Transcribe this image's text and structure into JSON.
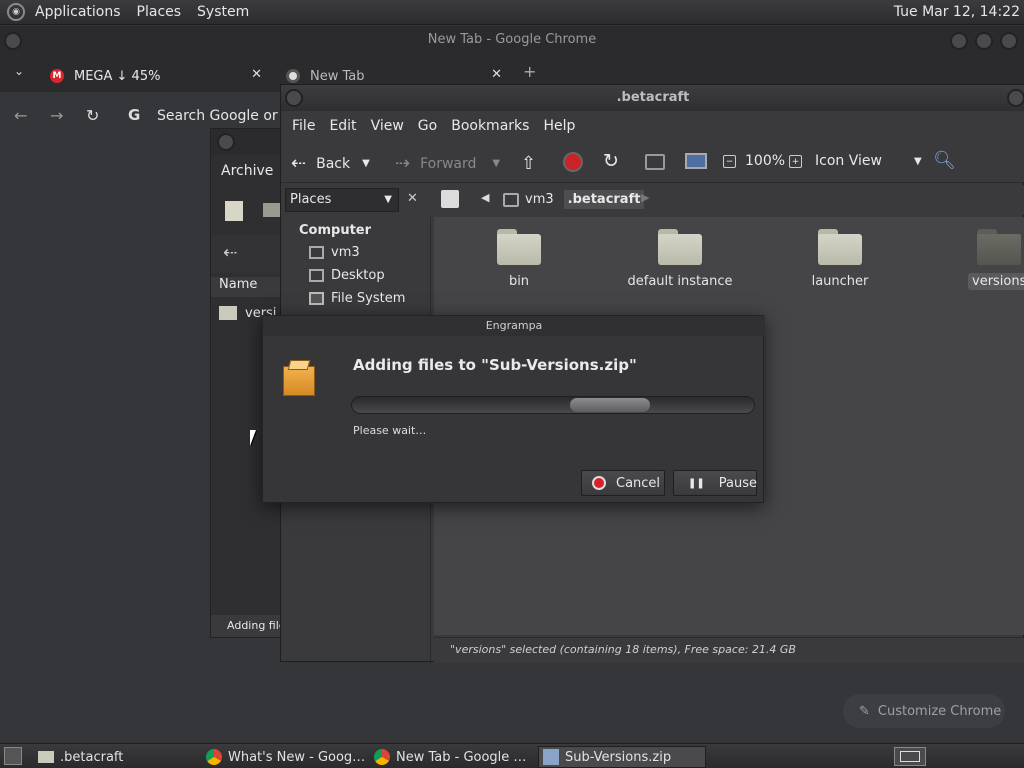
{
  "top_panel": {
    "menus": [
      "Applications",
      "Places",
      "System"
    ],
    "clock": "Tue Mar 12, 14:22"
  },
  "chrome": {
    "title": "New Tab - Google Chrome",
    "tabs": [
      {
        "label": "MEGA ↓ 45%",
        "favicon": "mega-icon",
        "close": "✕"
      },
      {
        "label": "New Tab",
        "favicon": "chrome-icon",
        "close": "✕"
      }
    ],
    "new_tab": "+",
    "omnibox_placeholder": "Search Google or ty",
    "customize_label": "Customize Chrome"
  },
  "archive_window": {
    "menu_label": "Archive",
    "column_name": "Name",
    "file_label": "versi",
    "status": "Adding file"
  },
  "file_manager": {
    "title": ".betacraft",
    "menu": [
      "File",
      "Edit",
      "View",
      "Go",
      "Bookmarks",
      "Help"
    ],
    "toolbar": {
      "back": "Back",
      "forward": "Forward",
      "zoom": "100%",
      "view_mode": "Icon View"
    },
    "sidebar": {
      "header": "Places",
      "section": "Computer",
      "items": [
        "vm3",
        "Desktop",
        "File System"
      ]
    },
    "breadcrumb": [
      "vm3",
      ".betacraft"
    ],
    "folders": [
      "bin",
      "default instance",
      "launcher",
      "versions"
    ],
    "selected_folder": "versions",
    "status": "\"versions\" selected (containing 18 items), Free space: 21.4 GB"
  },
  "dialog": {
    "title": "Engrampa",
    "heading": "Adding files to \"Sub-Versions.zip\"",
    "status": "Please wait…",
    "cancel_label": "Cancel",
    "pause_label": "Pause"
  },
  "taskbar": {
    "items": [
      ".betacraft",
      "What's New - Goog…",
      "New Tab - Google …",
      "Sub-Versions.zip"
    ],
    "active": "Sub-Versions.zip"
  },
  "colors": {
    "panel_bg": "#2c2c2e",
    "window_bg": "#3a3a3c",
    "icon_view_bg": "#454547",
    "folder": "#c9cabb",
    "mega_red": "#d9272e",
    "cancel_red": "#d8202a",
    "chrome_bg": "#35363a"
  }
}
